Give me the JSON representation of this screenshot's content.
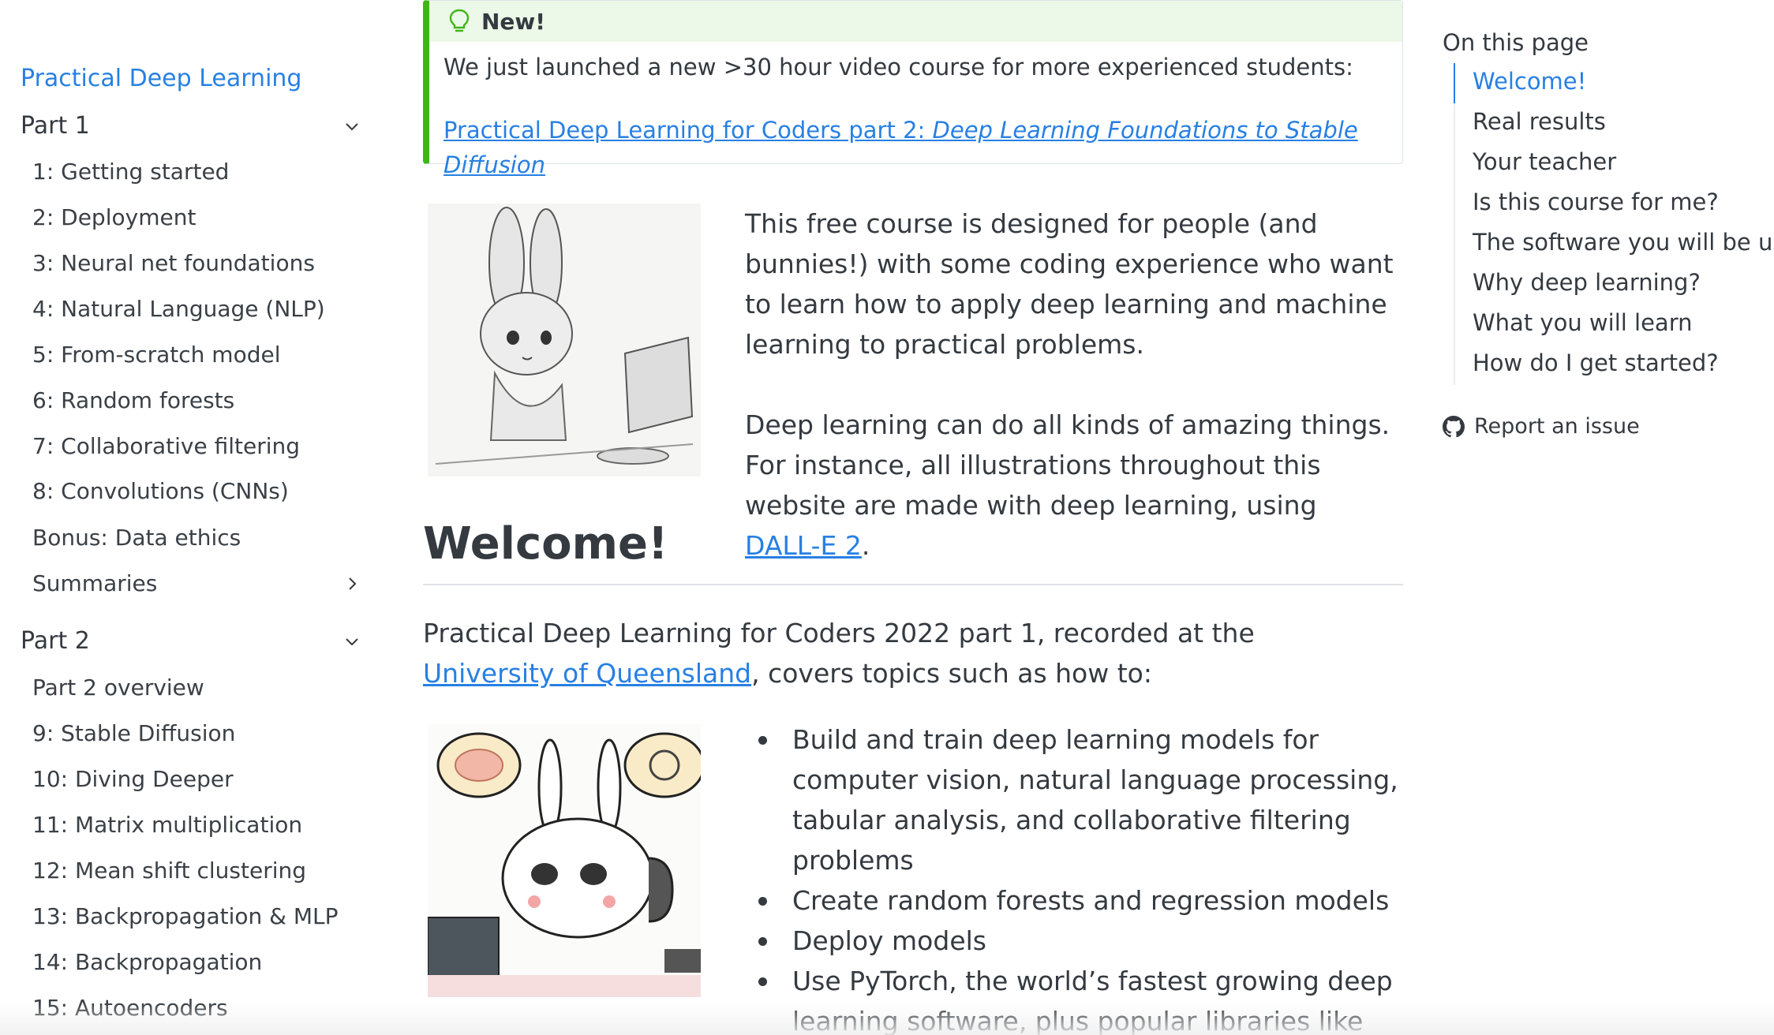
{
  "sidebar": {
    "title": "Practical Deep Learning",
    "part1": {
      "label": "Part 1",
      "items": [
        "1: Getting started",
        "2: Deployment",
        "3: Neural net foundations",
        "4: Natural Language (NLP)",
        "5: From-scratch model",
        "6: Random forests",
        "7: Collaborative filtering",
        "8: Convolutions (CNNs)",
        "Bonus: Data ethics"
      ],
      "summaries": "Summaries"
    },
    "part2": {
      "label": "Part 2",
      "items": [
        "Part 2 overview",
        "9: Stable Diffusion",
        "10: Diving Deeper",
        "11: Matrix multiplication",
        "12: Mean shift clustering",
        "13: Backpropagation & MLP",
        "14: Backpropagation",
        "15: Autoencoders"
      ]
    }
  },
  "callout": {
    "title": "New!",
    "text": "We just launched a new >30 hour video course for more experienced students:",
    "link_prefix": "Practical Deep Learning for Coders part 2: ",
    "link_italic": "Deep Learning Foundations to Stable Diffusion"
  },
  "intro": {
    "p1": "This free course is designed for people (and bunnies!) with some coding experience who want to learn how to apply deep learning and machine learning to practical problems.",
    "p2_before": "Deep learning can do all kinds of amazing things. For instance, all illustrations throughout this website are made with deep learning, using ",
    "p2_link": "DALL-E 2",
    "p2_after": "."
  },
  "welcome": {
    "heading": "Welcome!",
    "para_before": "Practical Deep Learning for Coders 2022 part 1, recorded at the ",
    "para_link": "University of Queensland",
    "para_after": ", covers topics such as how to:",
    "bullets": [
      "Build and train deep learning models for computer vision, natural language processing, tabular analysis, and collaborative filtering problems",
      "Create random forests and regression models",
      "Deploy models",
      "Use PyTorch, the world’s fastest growing deep learning software, plus popular libraries like fastai and Hugging Face"
    ]
  },
  "toc": {
    "title": "On this page",
    "items": [
      "Welcome!",
      "Real results",
      "Your teacher",
      "Is this course for me?",
      "The software you will be using",
      "Why deep learning?",
      "What you will learn",
      "How do I get started?"
    ],
    "active_index": 0,
    "report": "Report an issue"
  },
  "colors": {
    "link": "#2780e3",
    "callout_accent": "#3fb618",
    "text": "#343a40"
  }
}
